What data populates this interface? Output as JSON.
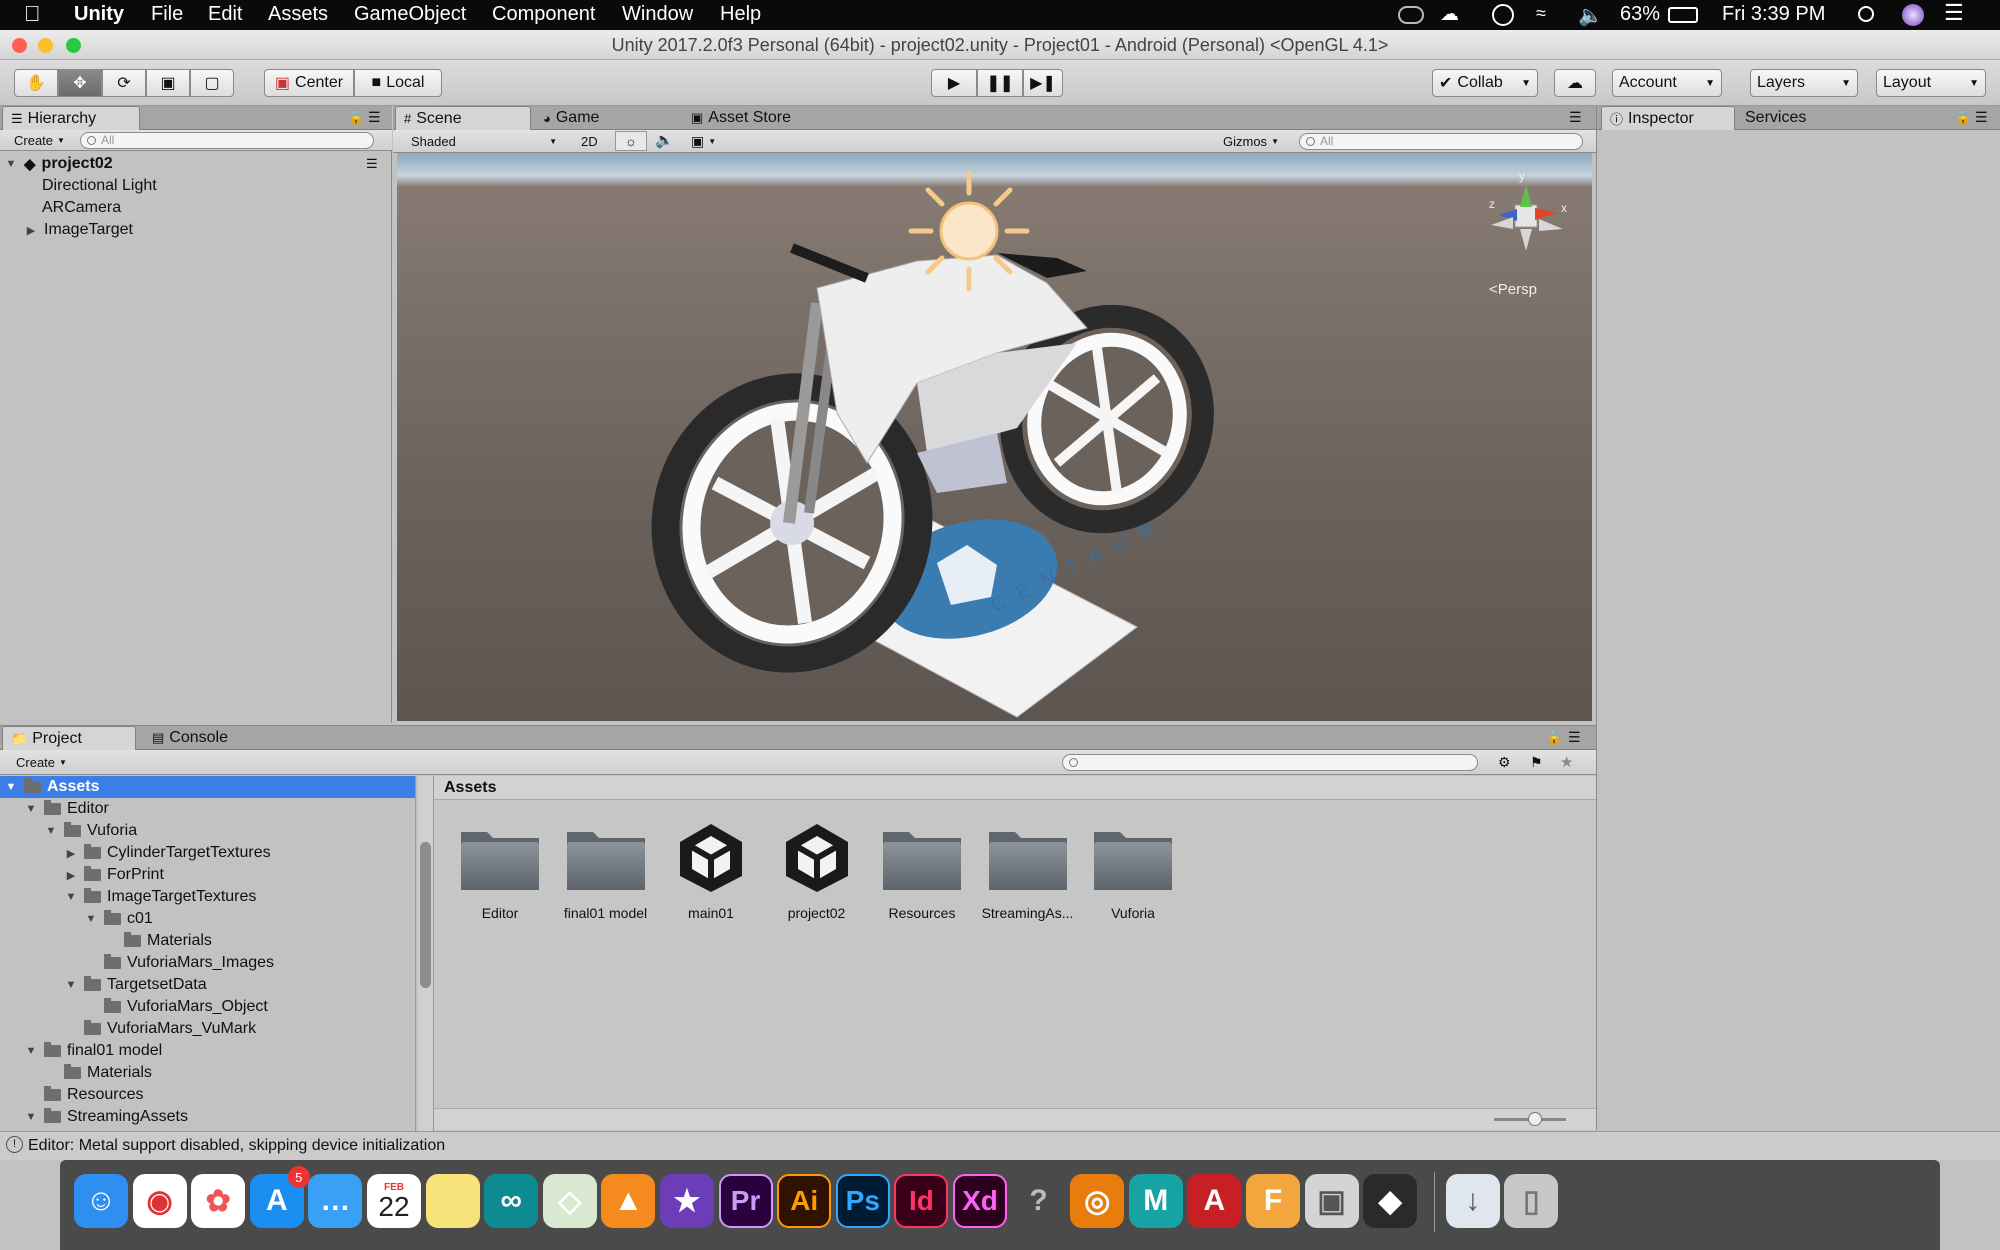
{
  "menubar": {
    "app": "Unity",
    "items": [
      "File",
      "Edit",
      "Assets",
      "GameObject",
      "Component",
      "Window",
      "Help"
    ],
    "battery": "63%",
    "clock": "Fri 3:39 PM"
  },
  "window": {
    "title": "Unity 2017.2.0f3 Personal (64bit) - project02.unity - Project01 - Android (Personal) <OpenGL 4.1>"
  },
  "toolbar": {
    "pivot": "Center",
    "space": "Local",
    "collab": "Collab",
    "account": "Account",
    "layers": "Layers",
    "layout": "Layout"
  },
  "hierarchy": {
    "tab": "Hierarchy",
    "create": "Create",
    "search_placeholder": "All",
    "scene": "project02",
    "items": [
      "Directional Light",
      "ARCamera",
      "ImageTarget"
    ]
  },
  "scene_view": {
    "tabs": [
      "Scene",
      "Game",
      "Asset Store"
    ],
    "shading": "Shaded",
    "mode2d": "2D",
    "gizmos": "Gizmos",
    "search_placeholder": "All",
    "projection": "Persp",
    "axes": [
      "y",
      "x",
      "z"
    ],
    "target_label": "CENTAUR"
  },
  "inspector": {
    "tabs": [
      "Inspector",
      "Services"
    ]
  },
  "project": {
    "tabs": [
      "Project",
      "Console"
    ],
    "create": "Create",
    "breadcrumb": "Assets",
    "tree": [
      {
        "label": "Assets",
        "depth": 0,
        "arrow": "open",
        "selected": true
      },
      {
        "label": "Editor",
        "depth": 1,
        "arrow": "open"
      },
      {
        "label": "Vuforia",
        "depth": 2,
        "arrow": "open"
      },
      {
        "label": "CylinderTargetTextures",
        "depth": 3,
        "arrow": "closed"
      },
      {
        "label": "ForPrint",
        "depth": 3,
        "arrow": "closed"
      },
      {
        "label": "ImageTargetTextures",
        "depth": 3,
        "arrow": "open"
      },
      {
        "label": "c01",
        "depth": 4,
        "arrow": "open"
      },
      {
        "label": "Materials",
        "depth": 5,
        "arrow": "none"
      },
      {
        "label": "VuforiaMars_Images",
        "depth": 4,
        "arrow": "none"
      },
      {
        "label": "TargetsetData",
        "depth": 3,
        "arrow": "open"
      },
      {
        "label": "VuforiaMars_Object",
        "depth": 4,
        "arrow": "none"
      },
      {
        "label": "VuforiaMars_VuMark",
        "depth": 3,
        "arrow": "none"
      },
      {
        "label": "final01 model",
        "depth": 1,
        "arrow": "open"
      },
      {
        "label": "Materials",
        "depth": 2,
        "arrow": "none"
      },
      {
        "label": "Resources",
        "depth": 1,
        "arrow": "none"
      },
      {
        "label": "StreamingAssets",
        "depth": 1,
        "arrow": "open"
      }
    ],
    "assets": [
      {
        "label": "Editor",
        "kind": "folder"
      },
      {
        "label": "final01 model",
        "kind": "folder"
      },
      {
        "label": "main01",
        "kind": "unity"
      },
      {
        "label": "project02",
        "kind": "unity"
      },
      {
        "label": "Resources",
        "kind": "folder"
      },
      {
        "label": "StreamingAs...",
        "kind": "folder"
      },
      {
        "label": "Vuforia",
        "kind": "folder"
      }
    ]
  },
  "status": {
    "message": "Editor: Metal support disabled, skipping device initialization"
  },
  "dock": {
    "calendar_month": "FEB",
    "calendar_day": "22",
    "appstore_badge": "5",
    "icons": [
      "Finder",
      "Chrome",
      "Photos",
      "App Store",
      "Messages",
      "Calendar",
      "Notes",
      "Arduino",
      "Maps",
      "VLC",
      "iMovie",
      "Pr",
      "Ai",
      "Ps",
      "Id",
      "Xd",
      "?",
      "Blender",
      "MAYA",
      "AS",
      "360",
      "Preview",
      "Unity",
      "Downloads",
      "Trash"
    ]
  }
}
